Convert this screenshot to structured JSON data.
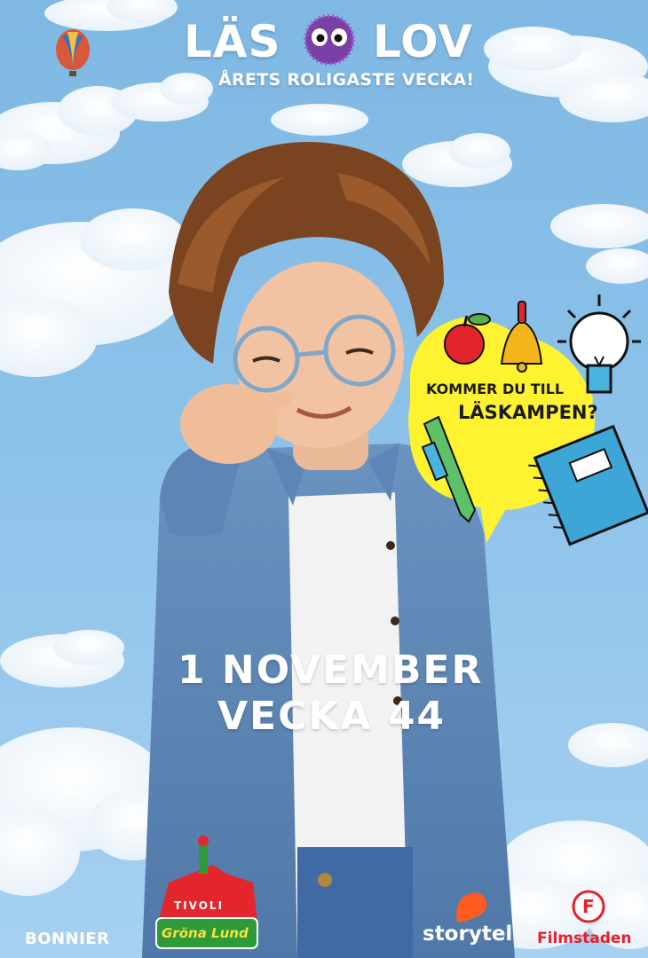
{
  "header": {
    "title_left": "LÄS",
    "title_right": "LOV",
    "tagline": "ÅRETS ROLIGASTE VECKA!"
  },
  "bubble": {
    "line1": "KOMMER DU TILL",
    "line2": "LÄSKAMPEN?"
  },
  "event": {
    "date": "1 NOVEMBER",
    "week": "VECKA 44"
  },
  "sponsors": {
    "bonnier": "BONNIER",
    "tivoli": "TIVOLI",
    "grona_lund": "Gröna Lund",
    "storytel": "storytel",
    "filmstaden": "Filmstaden",
    "filmstaden_mark": "F"
  },
  "colors": {
    "sky": "#8cc2ea",
    "bubble_yellow": "#fff231",
    "mascot_purple": "#7a3fa6",
    "storytel_orange": "#ff5a1f",
    "filmstaden_red": "#e5202b",
    "tivoli_green": "#2f9a3a"
  }
}
